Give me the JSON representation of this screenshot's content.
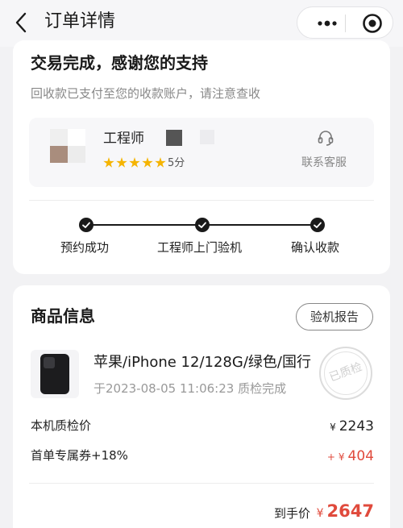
{
  "nav": {
    "title": "订单详情",
    "back_icon": "chevron-left-icon",
    "more_icon": "more-dots-icon",
    "close_icon": "target-icon"
  },
  "status": {
    "title": "交易完成，感谢您的支持",
    "subtitle": "回收款已支付至您的收款账户，请注意查收"
  },
  "engineer": {
    "name": "工程师",
    "rating_stars": 5,
    "score": "5分",
    "customer_service": "联系客服",
    "customer_service_icon": "headset-icon"
  },
  "steps": [
    {
      "label": "预约成功",
      "done": true
    },
    {
      "label": "工程师上门验机",
      "done": true
    },
    {
      "label": "确认收款",
      "done": true
    }
  ],
  "product": {
    "section_title": "商品信息",
    "report_button": "验机报告",
    "name": "苹果/iPhone 12/128G/绿色/国行",
    "time": "于2023-08-05 11:06:23 质检完成",
    "stamp": "已质检"
  },
  "prices": {
    "currency": "¥",
    "inspection_label": "本机质检价",
    "inspection_value": "2243",
    "coupon_label": "首单专属券+18%",
    "coupon_prefix": "+",
    "coupon_value": "404",
    "total_label": "到手价",
    "total_value": "2647"
  },
  "colors": {
    "accent_red": "#e04a3c",
    "star": "#f5b400"
  }
}
